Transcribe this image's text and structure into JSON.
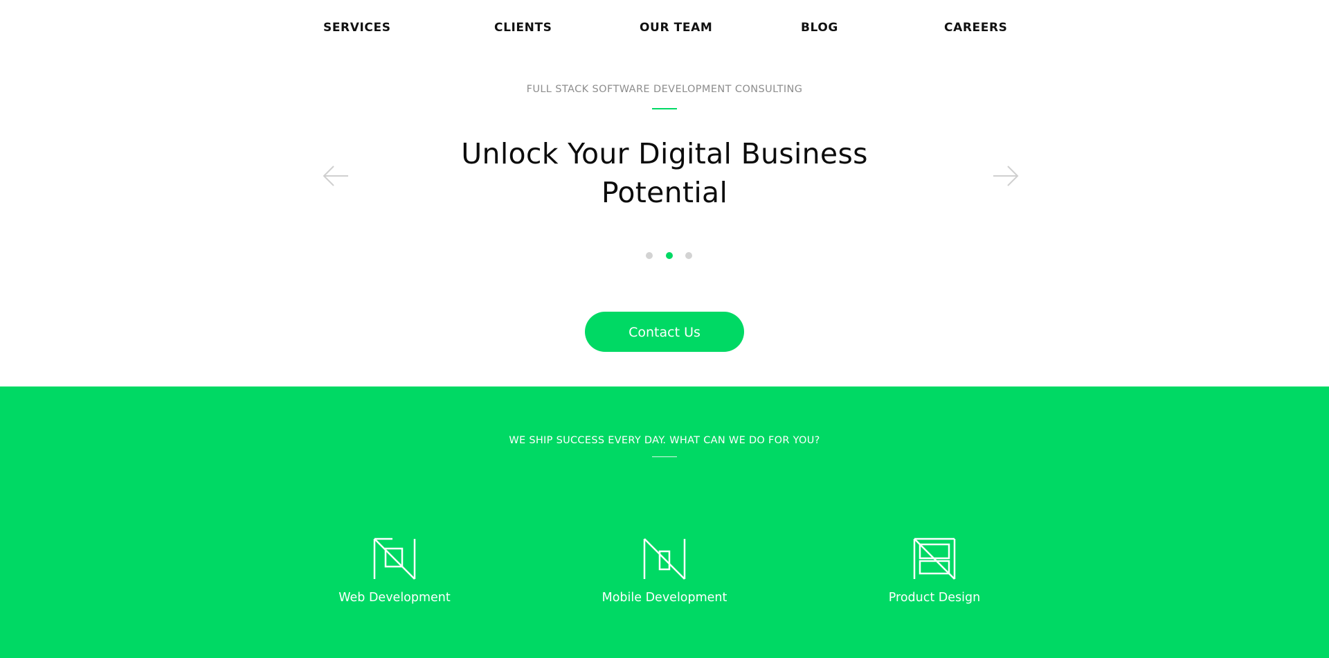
{
  "nav": {
    "items": [
      {
        "label": "SERVICES"
      },
      {
        "label": "CLIENTS"
      },
      {
        "label": "OUR TEAM"
      },
      {
        "label": "BLOG"
      },
      {
        "label": "CAREERS"
      }
    ]
  },
  "hero": {
    "eyebrow": "FULL STACK SOFTWARE DEVELOPMENT CONSULTING",
    "title_line1": "Unlock Your Digital Business",
    "title_line2": "Potential",
    "prev_icon": "arrow-left-icon",
    "next_icon": "arrow-right-icon",
    "slides_total": 3,
    "active_slide": 2,
    "cta_label": "Contact Us"
  },
  "services": {
    "heading": "WE SHIP SUCCESS EVERY DAY. WHAT CAN WE DO FOR YOU?",
    "items": [
      {
        "label": "Web Development",
        "icon": "web-development-icon"
      },
      {
        "label": "Mobile Development",
        "icon": "mobile-development-icon"
      },
      {
        "label": "Product Design",
        "icon": "product-design-icon"
      }
    ]
  },
  "colors": {
    "accent": "#00d964",
    "text": "#111111",
    "muted": "#8d8d8d",
    "dot_inactive": "#d3d3d3",
    "on_accent": "#ffffff"
  }
}
